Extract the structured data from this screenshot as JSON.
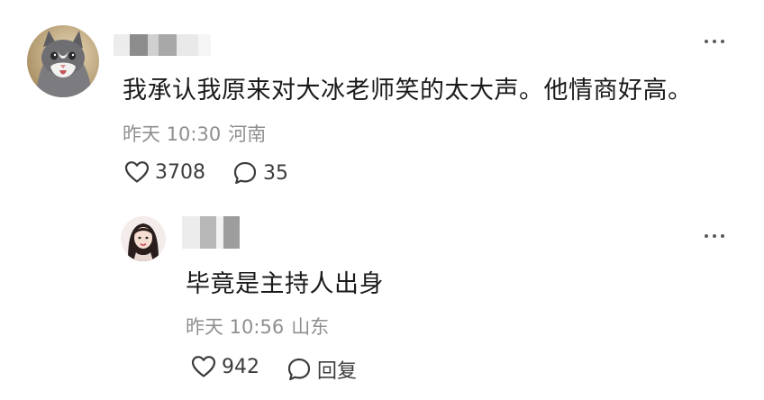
{
  "comment": {
    "text": "我承认我原来对大冰老师笑的太大声。他情商好高。",
    "time": "昨天 10:30",
    "location": "河南",
    "likes": "3708",
    "replies": "35",
    "avatar_icon": "cat-avatar-icon",
    "more_icon": "more-dots-icon"
  },
  "reply": {
    "text": "毕竟是主持人出身",
    "time": "昨天 10:56",
    "location": "山东",
    "likes": "942",
    "reply_label": "回复",
    "avatar_icon": "girl-avatar-icon",
    "more_icon": "more-dots-icon"
  },
  "colors": {
    "text": "#1a1a1a",
    "meta": "#8f8f8f",
    "icon": "#3c3c3c",
    "background": "#ffffff"
  }
}
